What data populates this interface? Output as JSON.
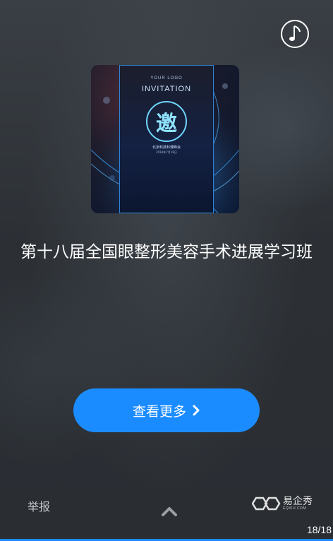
{
  "cover": {
    "logo_text": "YOUR LOGO",
    "title": "INVITATION",
    "big_char": "邀",
    "org_text": "北京科技科博峰会",
    "date_text": "2018年7月18日"
  },
  "main": {
    "title": "第十八届全国眼整形美容手术进展学习班",
    "more_button_label": "查看更多"
  },
  "footer": {
    "report_label": "举报",
    "brand_name": "易企秀",
    "brand_url": "EQXIU.COM",
    "page_indicator": "18/18",
    "progress": 1.0
  },
  "colors": {
    "accent": "#1b8cff",
    "text": "#ffffff"
  },
  "icons": {
    "music": "music-note-icon",
    "arrow": "chevron-right-icon",
    "up": "chevron-up-icon",
    "brand": "eqxiu-logo-icon"
  }
}
